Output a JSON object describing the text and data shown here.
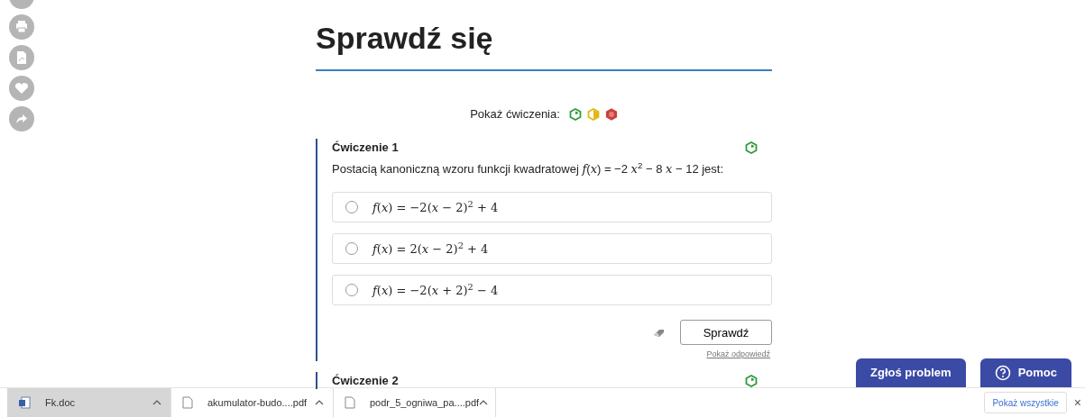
{
  "title": "Sprawdź się",
  "filter": {
    "label": "Pokaż ćwiczenia:",
    "levels": [
      {
        "kind": "outline",
        "color": "#2e9b3c"
      },
      {
        "kind": "half",
        "color": "#e2b714"
      },
      {
        "kind": "filled",
        "color": "#c9403a"
      }
    ]
  },
  "exercises": [
    {
      "title": "Ćwiczenie 1",
      "level": {
        "kind": "outline",
        "color": "#2e9b3c"
      },
      "question": "Postacią kanoniczną wzoru funkcji kwadratowej *f*(*x*) = −2 *x*$^{2}$ − 8 *x* − 12 jest:",
      "options": [
        {
          "text": "*f*(*x*) = −2(*x* − 2)$^{2}$ + 4",
          "selected": false
        },
        {
          "text": "*f*(*x*) = 2(*x* − 2)$^{2}$ + 4",
          "selected": false
        },
        {
          "text": "*f*(*x*) = −2(*x* + 2)$^{2}$ − 4",
          "selected": false
        }
      ],
      "check_button": "Sprawdź",
      "show_answer": "Pokaż odpowiedź"
    },
    {
      "title": "Ćwiczenie 2",
      "level": {
        "kind": "outline",
        "color": "#2e9b3c"
      }
    }
  ],
  "help_buttons": [
    {
      "label": "Zgłoś problem",
      "kind": "plain"
    },
    {
      "label": "Pomoc",
      "kind": "help"
    }
  ],
  "downloads": [
    {
      "name": "Fk.doc",
      "kind": "word",
      "selected": true
    },
    {
      "name": "akumulator-budo....pdf",
      "kind": "file",
      "selected": false
    },
    {
      "name": "podr_5_ogniwa_pa....pdf",
      "kind": "file",
      "selected": false
    }
  ],
  "show_all": "Pokaż wszystkie",
  "close": "×"
}
